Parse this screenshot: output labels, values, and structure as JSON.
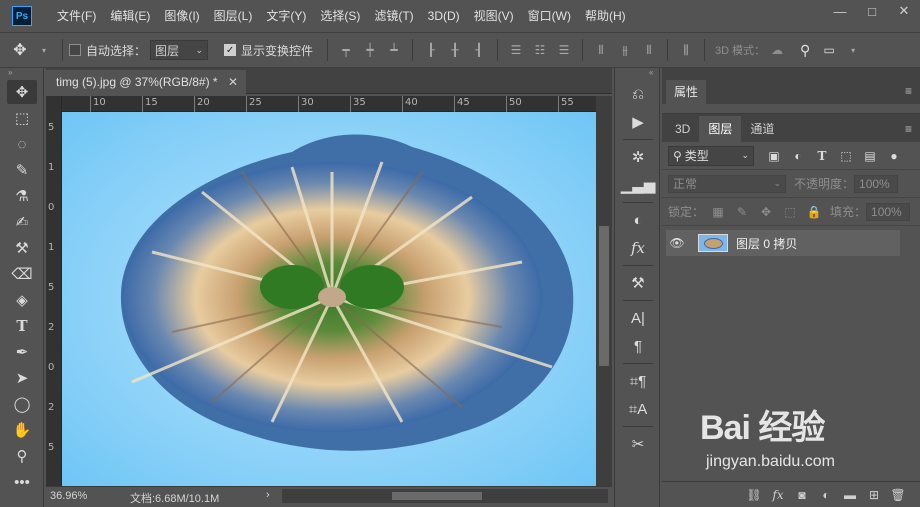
{
  "app": {
    "logo_text": "Ps",
    "menu": [
      "文件(F)",
      "编辑(E)",
      "图像(I)",
      "图层(L)",
      "文字(Y)",
      "选择(S)",
      "滤镜(T)",
      "3D(D)",
      "视图(V)",
      "窗口(W)",
      "帮助(H)"
    ],
    "window_controls": [
      "—",
      "□",
      "✕"
    ]
  },
  "options_bar": {
    "auto_select_label": "自动选择：",
    "auto_select_checked": false,
    "auto_select_target": "图层",
    "show_transform_label": "显示变换控件",
    "show_transform_checked": true,
    "mode_3d_label": "3D 模式："
  },
  "document": {
    "tab_title": "timg (5).jpg @ 37%(RGB/8#) *",
    "zoom": "36.96%",
    "doc_info": "文档:6.68M/10.1M",
    "status_arrow": "›",
    "ruler_h_labels": [
      "10",
      "15",
      "20",
      "25",
      "30",
      "35",
      "40",
      "45",
      "50",
      "55"
    ],
    "ruler_v_labels": [
      "5",
      "1",
      "0",
      "1",
      "5",
      "2",
      "0",
      "2",
      "5"
    ]
  },
  "panels": {
    "properties_tab": "属性",
    "layers_tabs": [
      "3D",
      "图层",
      "通道"
    ],
    "active_layers_tab": "图层",
    "filter_kind": "类型",
    "blend_mode": "正常",
    "opacity_label": "不透明度：",
    "opacity_value": "100%",
    "lock_label": "锁定：",
    "fill_label": "填充：",
    "fill_value": "100%",
    "layers": [
      {
        "name": "图层 0 拷贝",
        "visible": true
      }
    ]
  },
  "watermark": {
    "logo": "Bai 经验",
    "url": "jingyan.baidu.com"
  }
}
